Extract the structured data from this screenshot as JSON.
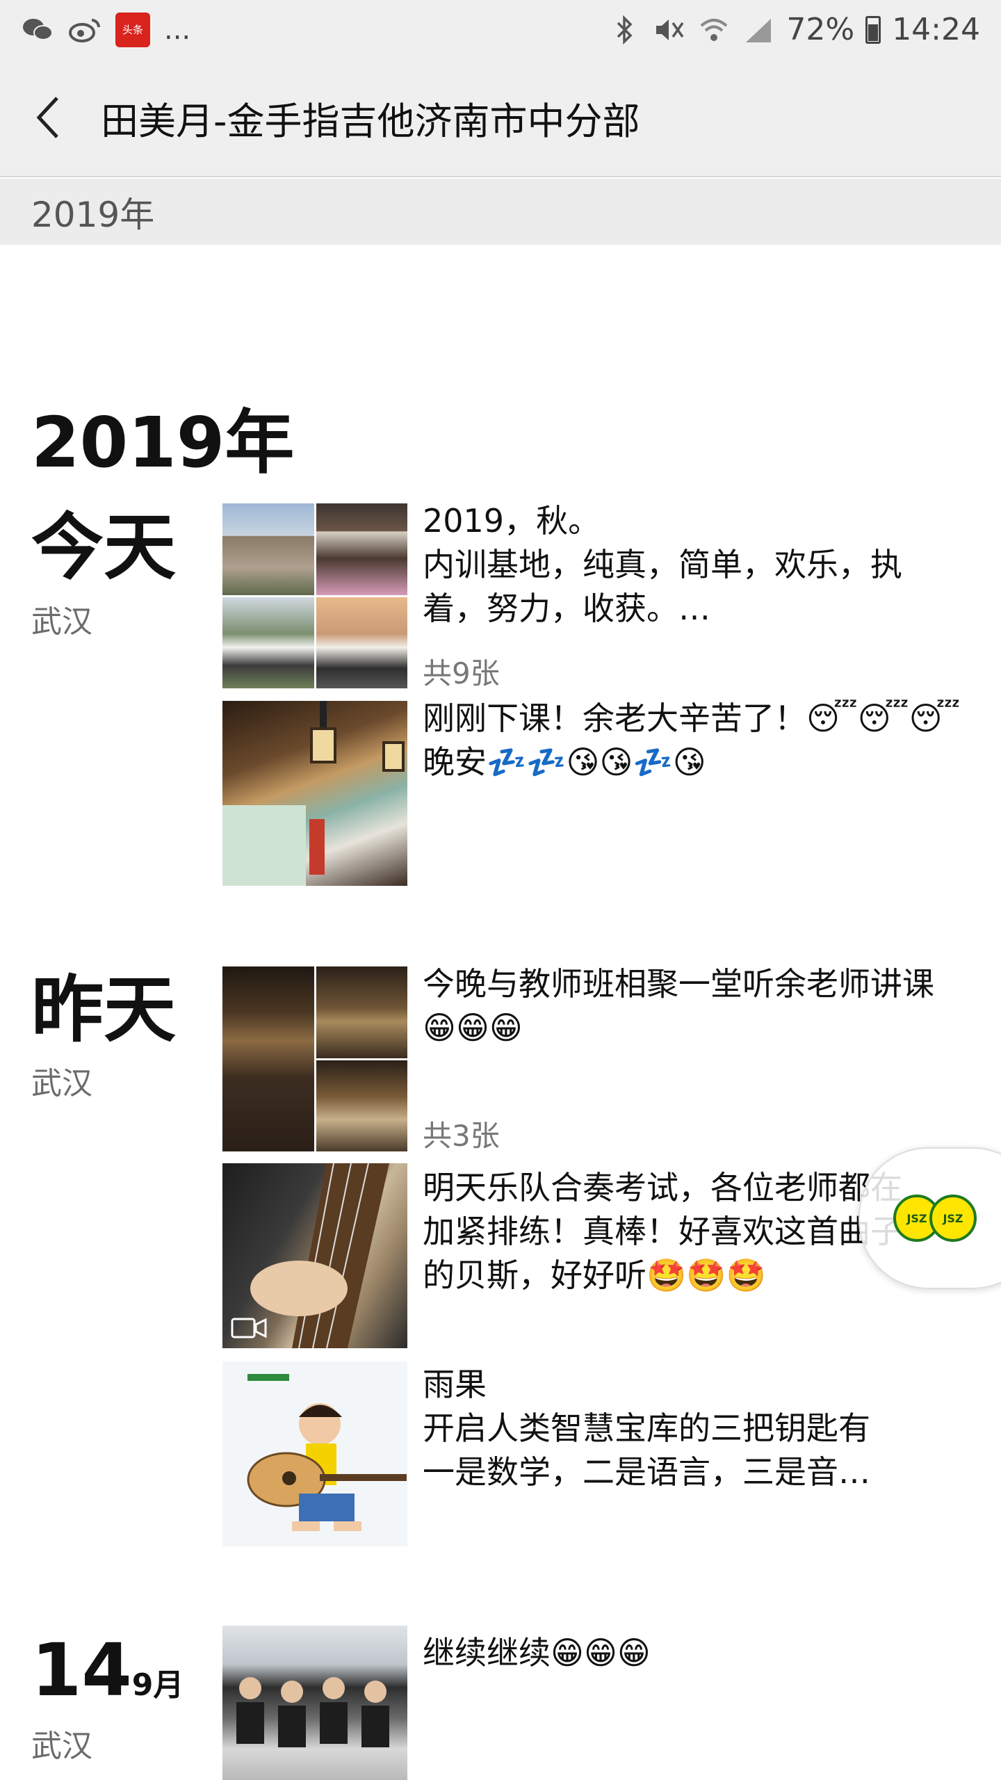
{
  "status_bar": {
    "battery": "72%",
    "time": "14:24",
    "toutiao_label": "头条",
    "more": "..."
  },
  "navbar": {
    "title": "田美月-金手指吉他济南市中分部"
  },
  "sticky_year": "2019年",
  "year_heading": "2019年",
  "days": [
    {
      "label": "今天",
      "location": "武汉"
    },
    {
      "label": "昨天",
      "location": "武汉"
    },
    {
      "day": "14",
      "month": "9月",
      "location": "武汉"
    }
  ],
  "posts": [
    {
      "text": "2019，秋。\n内训基地，纯真，简单，欢乐，执\n着，努力，收获。…",
      "count": "共9张"
    },
    {
      "text": "刚刚下课！余老大辛苦了！😴😴😴\n晚安💤💤😘😘💤😘"
    },
    {
      "text": "今晚与教师班相聚一堂听余老师讲课\n😁😁😁",
      "count": "共3张"
    },
    {
      "text": "明天乐队合奏考试，各位老师都在\n加紧排练！真棒！好喜欢这首曲子\n的贝斯，好好听🤩🤩🤩"
    },
    {
      "text": "雨果\n开启人类智慧宝库的三把钥匙有\n一是数学，二是语言，三是音…"
    },
    {
      "text": "继续继续😁😁😁"
    }
  ],
  "float_badge": {
    "label": "JSZ"
  },
  "colors": {
    "header_bg": "#efefef",
    "yearbar_bg": "#ececec",
    "location_text": "#6b6b6b"
  }
}
